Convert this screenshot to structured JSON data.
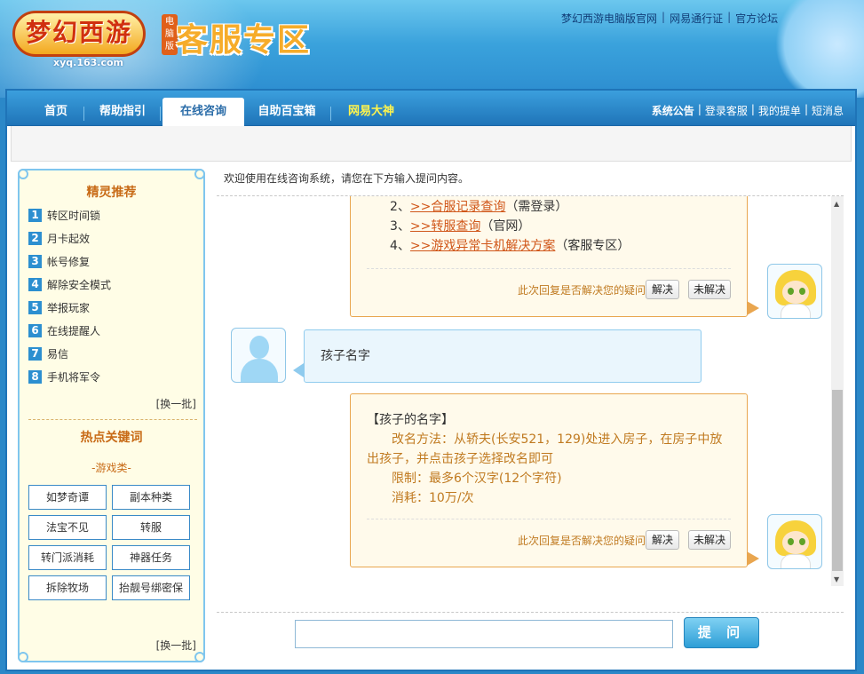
{
  "header": {
    "logo_text": "梦幻西游",
    "logo_badge": "电脑版",
    "logo_url": "xyq.163.com",
    "zone_title": "客服专区",
    "top_links": [
      "梦幻西游电脑版官网",
      "网易通行证",
      "官方论坛"
    ]
  },
  "nav": {
    "tabs": [
      {
        "label": "首页"
      },
      {
        "label": "帮助指引"
      },
      {
        "label": "在线咨询"
      },
      {
        "label": "自助百宝箱"
      },
      {
        "label": "网易大神"
      }
    ],
    "active_tab": "在线咨询",
    "right_links": [
      "系统公告",
      "登录客服",
      "我的提单",
      "短消息"
    ]
  },
  "sidebar": {
    "recommend_title": "精灵推荐",
    "recommend_items": [
      {
        "num": "1",
        "label": "转区时间锁"
      },
      {
        "num": "2",
        "label": "月卡起效"
      },
      {
        "num": "3",
        "label": "帐号修复"
      },
      {
        "num": "4",
        "label": "解除安全模式"
      },
      {
        "num": "5",
        "label": "举报玩家"
      },
      {
        "num": "6",
        "label": "在线提醒人"
      },
      {
        "num": "7",
        "label": "易信"
      },
      {
        "num": "8",
        "label": "手机将军令"
      }
    ],
    "refresh_label": "[换一批]",
    "hot_title": "热点关键词",
    "hot_category": "-游戏类-",
    "keywords": [
      "如梦奇谭",
      "副本种类",
      "法宝不见",
      "转服",
      "转门派消耗",
      "神器任务",
      "拆除牧场",
      "抬靓号绑密保"
    ],
    "refresh_label_2": "[换一批]"
  },
  "main": {
    "welcome": "欢迎使用在线咨询系统，请您在下方输入提问内容。",
    "messages": [
      {
        "role": "bot",
        "lines": [
          {
            "prefix": "2、",
            "link": ">>合服记录查询",
            "suffix": "（需登录）"
          },
          {
            "prefix": "3、",
            "link": ">>转服查询",
            "suffix": "（官网）"
          },
          {
            "prefix": "4、",
            "link": ">>游戏异常卡机解决方案",
            "suffix": "（客服专区）"
          }
        ],
        "feedback_question": "此次回复是否解决您的疑问:",
        "solved": "解决",
        "unsolved": "未解决"
      },
      {
        "role": "user",
        "text": "孩子名字"
      },
      {
        "role": "bot",
        "title": "【孩子的名字】",
        "body": "改名方法：从轿夫(长安521，129)处进入房子，在房子中放出孩子，并点击孩子选择改名即可",
        "body_line1": "改名方法：从轿夫(长安521，129)处进入房子，在房子中放",
        "body_line2": "出孩子，并点击孩子选择改名即可",
        "limit": "限制：最多6个汉字(12个字符)",
        "cost": "消耗：10万/次",
        "feedback_question": "此次回复是否解决您的疑问:",
        "solved": "解决",
        "unsolved": "未解决"
      }
    ],
    "input_value": "",
    "ask_button": "提 问"
  },
  "colors": {
    "nav_bg": "#1f74b8",
    "bot_bubble_border": "#e9a64f",
    "link": "#d0571a",
    "sidebar_title": "#c86b17"
  }
}
